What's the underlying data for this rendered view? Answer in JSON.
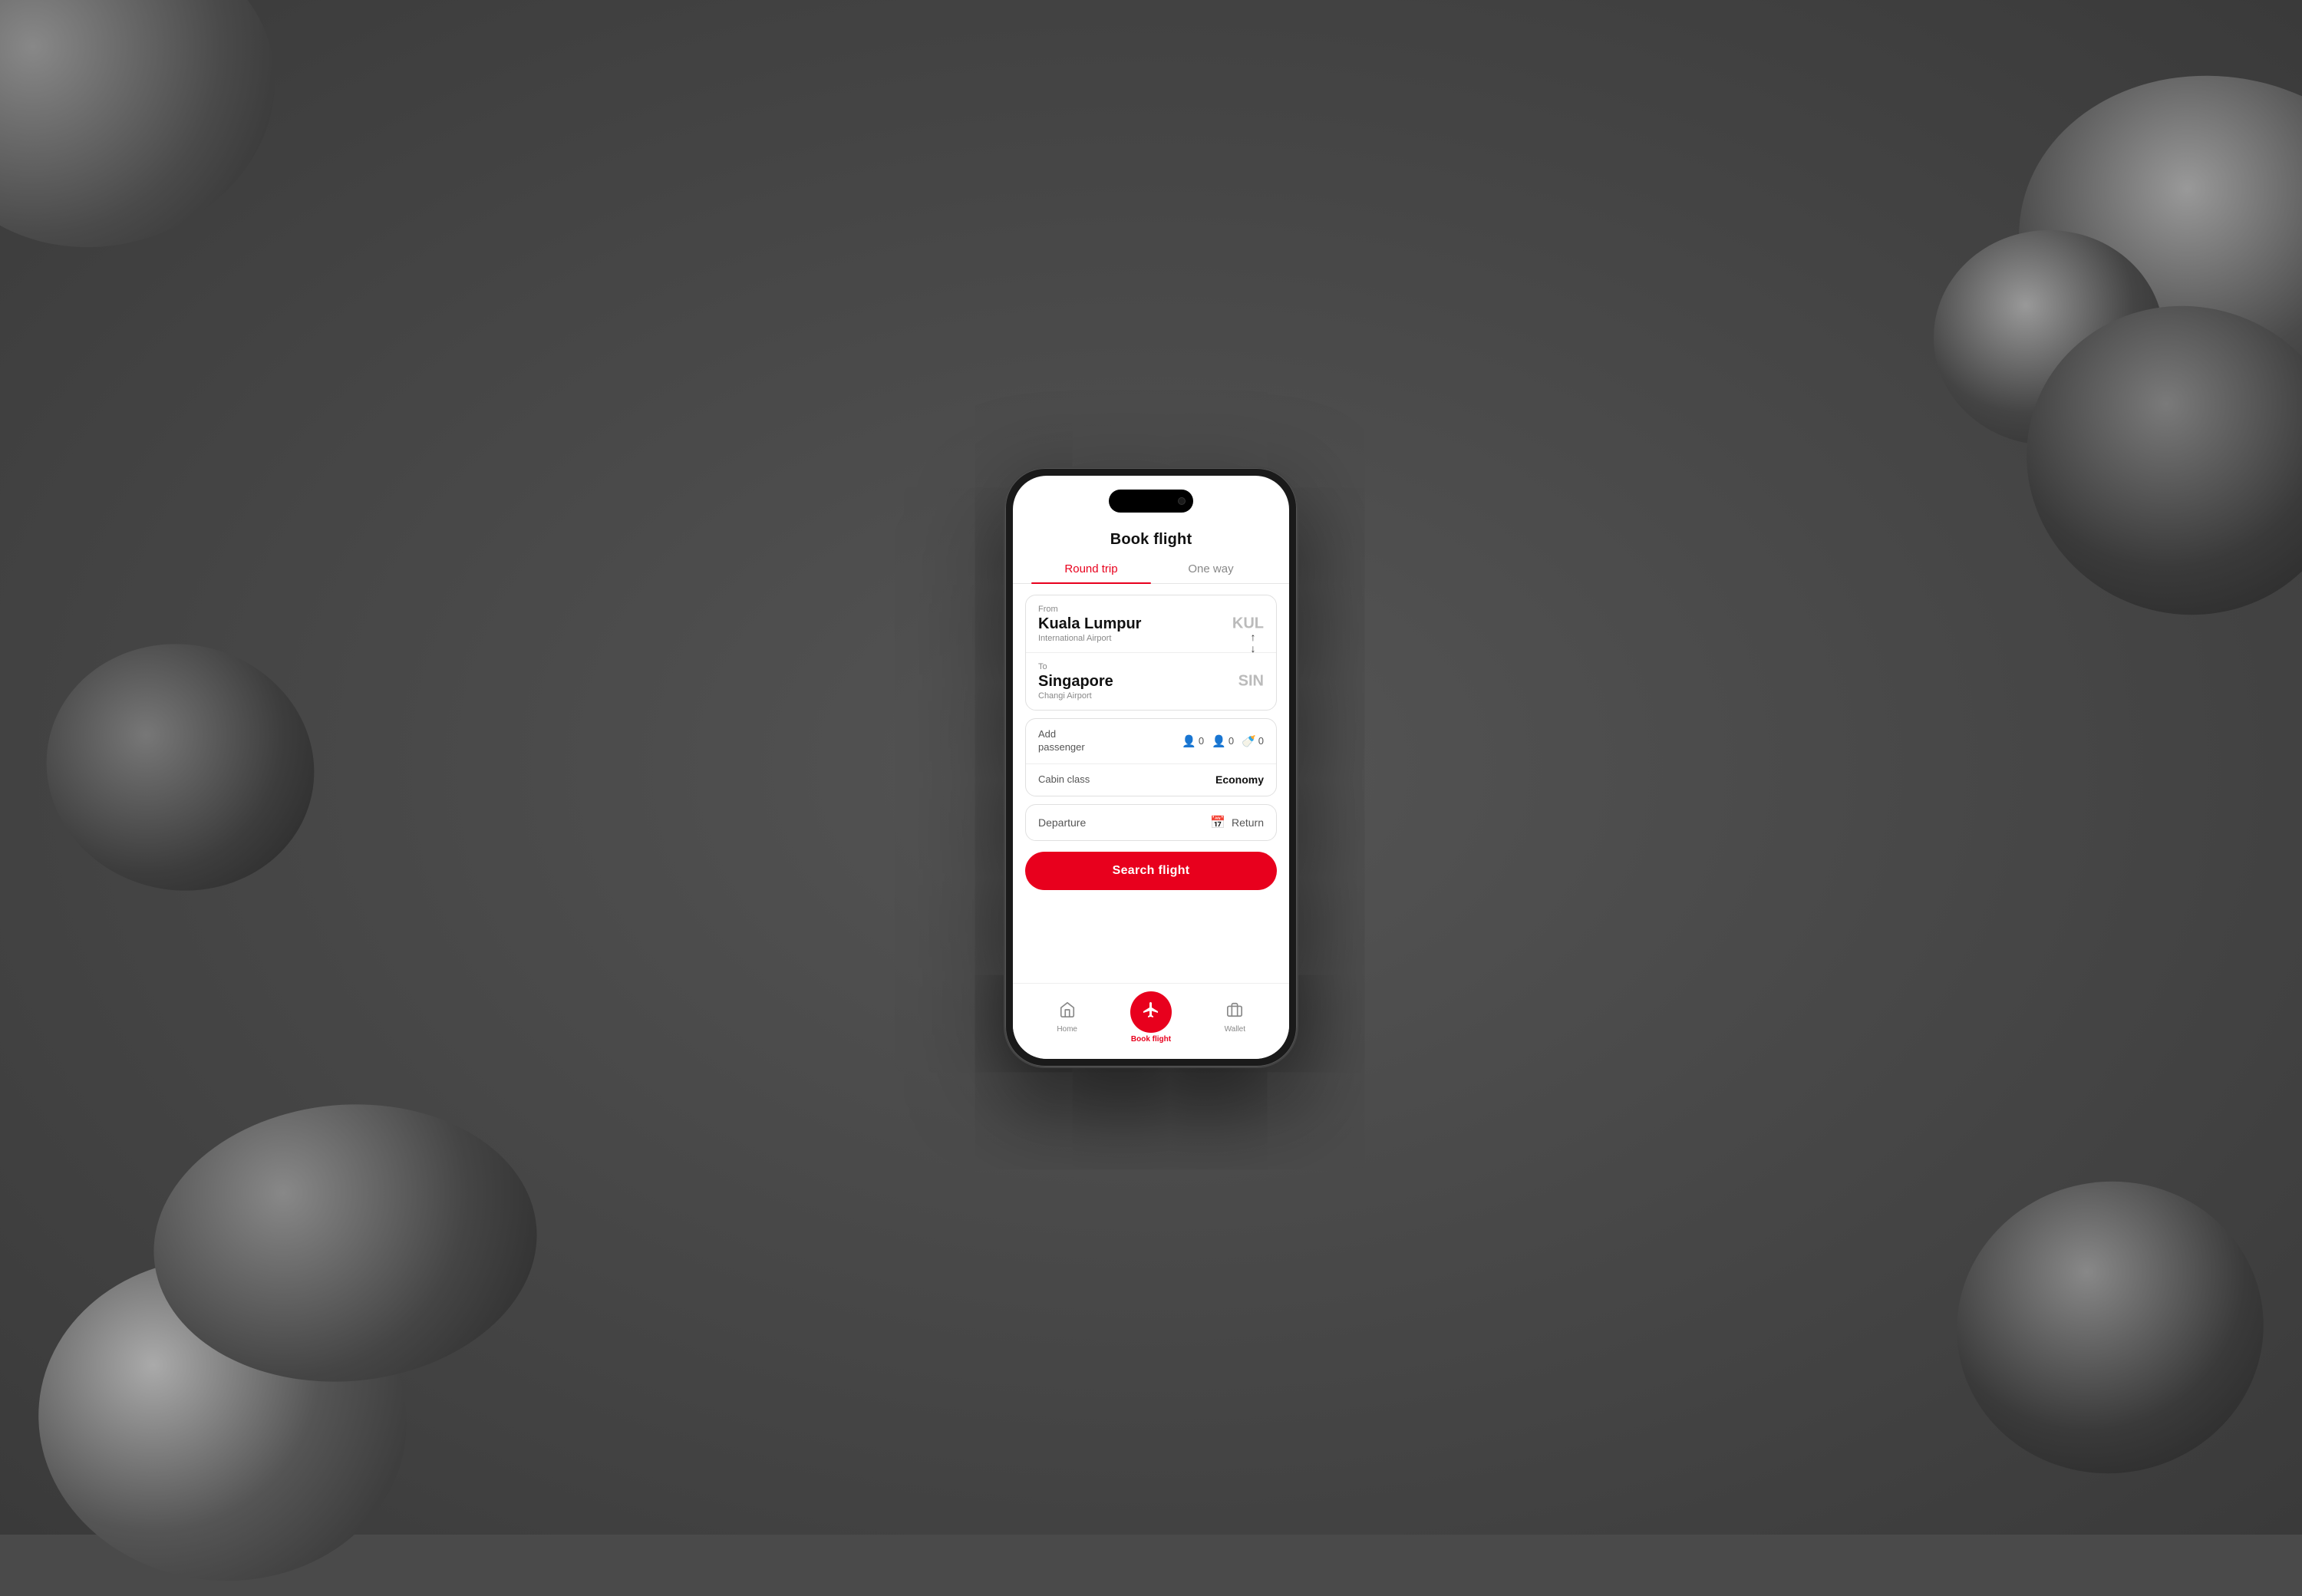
{
  "app": {
    "title": "Book flight"
  },
  "tabs": [
    {
      "id": "round-trip",
      "label": "Round trip",
      "active": true
    },
    {
      "id": "one-way",
      "label": "One way",
      "active": false
    }
  ],
  "from": {
    "label": "From",
    "city": "Kuala Lumpur",
    "airport": "International Airport",
    "code": "KUL"
  },
  "to": {
    "label": "To",
    "city": "Singapore",
    "airport": "Changi Airport",
    "code": "SIN"
  },
  "passengers": {
    "label": "Add\npassenger",
    "adults": 0,
    "children": 0,
    "infants": 0
  },
  "cabin": {
    "label": "Cabin class",
    "value": "Economy"
  },
  "dates": {
    "departure_label": "Departure",
    "return_label": "Return"
  },
  "search_button": "Search flight",
  "bottom_nav": [
    {
      "id": "home",
      "label": "Home",
      "icon": "🏠",
      "active": false
    },
    {
      "id": "book-flight",
      "label": "Book flight",
      "icon": "✈",
      "active": true
    },
    {
      "id": "wallet",
      "label": "Wallet",
      "icon": "👛",
      "active": false
    }
  ],
  "colors": {
    "primary": "#e8001d",
    "active_tab": "#e8001d",
    "inactive_tab": "#888"
  }
}
